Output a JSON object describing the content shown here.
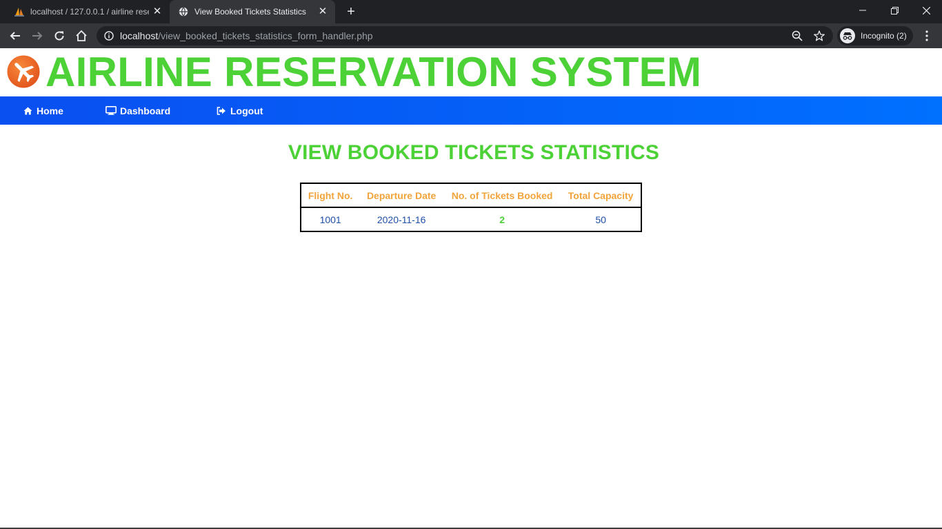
{
  "browser": {
    "tabs": [
      {
        "title": "localhost / 127.0.0.1 / airline rese",
        "active": false,
        "favicon": "phpmyadmin-sail-icon"
      },
      {
        "title": "View Booked Tickets Statistics",
        "active": true,
        "favicon": "globe-icon"
      }
    ],
    "url_host": "localhost",
    "url_path": "/view_booked_tickets_statistics_form_handler.php",
    "incognito_label": "Incognito (2)"
  },
  "site": {
    "title": "AIRLINE RESERVATION SYSTEM",
    "title_color": "#4cd137",
    "nav": [
      {
        "label": "Home",
        "icon": "home-icon"
      },
      {
        "label": "Dashboard",
        "icon": "desktop-icon"
      },
      {
        "label": "Logout",
        "icon": "sign-out-icon"
      }
    ],
    "nav_color": "#0a4ff0"
  },
  "main": {
    "heading": "VIEW BOOKED TICKETS STATISTICS",
    "table": {
      "headers": [
        "Flight No.",
        "Departure Date",
        "No. of Tickets Booked",
        "Total Capacity"
      ],
      "rows": [
        [
          "1001",
          "2020-11-16",
          "2",
          "50"
        ]
      ]
    }
  }
}
